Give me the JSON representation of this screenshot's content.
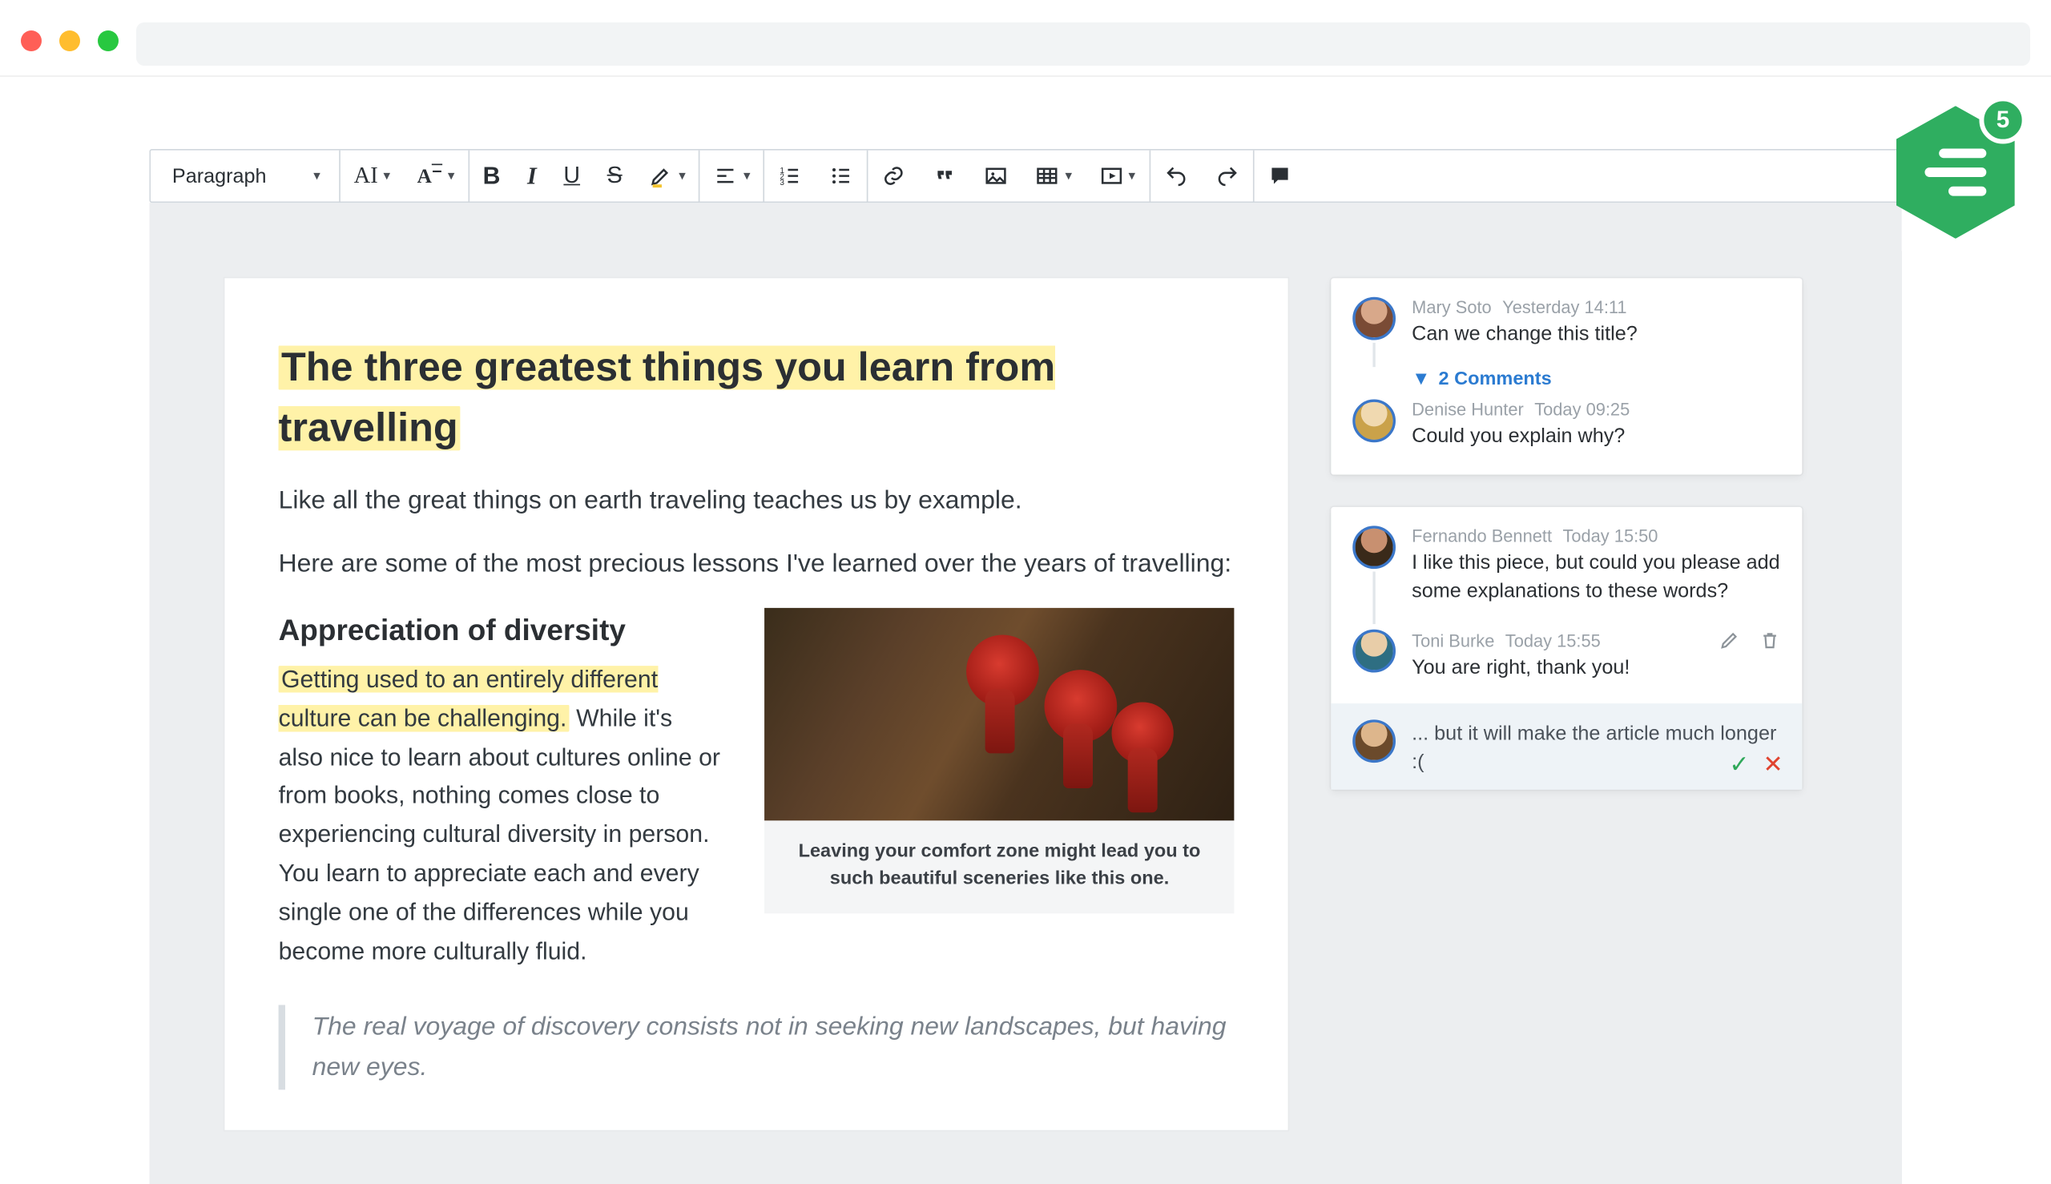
{
  "badge": {
    "count": "5"
  },
  "toolbar": {
    "block_style": "Paragraph",
    "font_family_label": "AI",
    "font_size_label": "A",
    "bold": "B",
    "italic": "I",
    "underline": "U",
    "strike": "S"
  },
  "document": {
    "title": "The three greatest things you learn from travelling",
    "lead1": "Like all the great things on earth traveling teaches us by example.",
    "lead2": "Here are some of the most precious lessons I've learned over the years of travelling:",
    "h2": "Appreciation of diversity",
    "p_highlighted": "Getting used to an entirely different culture can be challenging.",
    "p_rest": " While it's also nice to learn about cultures online or from books, nothing comes close to experiencing cultural diversity in person. You learn to appreciate each and every single one of the differences while you become more culturally fluid.",
    "caption": "Leaving your comfort zone might lead you to such beautiful sceneries like this one.",
    "quote": "The real voyage of discovery consists not in seeking new landscapes, but having new eyes."
  },
  "comments": {
    "thread1": {
      "c1": {
        "author": "Mary Soto",
        "time": "Yesterday 14:11",
        "text": "Can we change this title?"
      },
      "toggle": "2 Comments",
      "c2": {
        "author": "Denise Hunter",
        "time": "Today 09:25",
        "text": "Could you explain why?"
      }
    },
    "thread2": {
      "c1": {
        "author": "Fernando Bennett",
        "time": "Today 15:50",
        "text": "I like this piece, but could you please add some explanations to these words?"
      },
      "c2": {
        "author": "Toni Burke",
        "time": "Today 15:55",
        "text": "You are right, thank you!"
      },
      "reply_draft": "... but it will make the article much longer :("
    }
  }
}
